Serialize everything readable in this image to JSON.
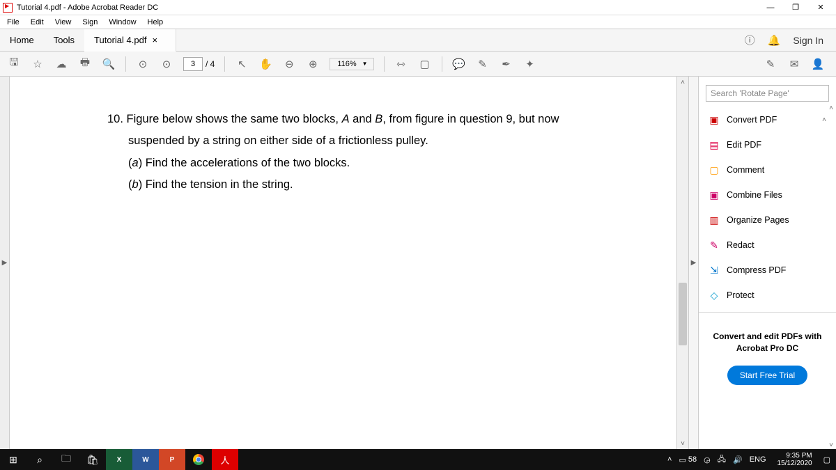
{
  "title": "Tutorial 4.pdf - Adobe Acrobat Reader DC",
  "menu": {
    "file": "File",
    "edit": "Edit",
    "view": "View",
    "sign": "Sign",
    "window": "Window",
    "help": "Help"
  },
  "tabs": {
    "home": "Home",
    "tools": "Tools",
    "file": "Tutorial 4.pdf"
  },
  "signin": "Sign In",
  "page": {
    "current": "3",
    "total": "/ 4"
  },
  "zoom": "116%",
  "doc": {
    "line1": "10. Figure below shows the same two blocks, ",
    "a": "A",
    "and": " and ",
    "b": "B",
    "line1b": ", from figure in question 9, but now",
    "line2": "suspended by a string on either side of a frictionless pulley.",
    "pa": "(",
    "paL": "a",
    "pa2": ") Find the accelerations of the two blocks.",
    "pb": "(",
    "pbL": "b",
    "pb2": ") Find the tension in the string."
  },
  "search_placeholder": "Search 'Rotate Page'",
  "tools_list": {
    "convert": "Convert PDF",
    "edit": "Edit PDF",
    "comment": "Comment",
    "combine": "Combine Files",
    "organize": "Organize Pages",
    "redact": "Redact",
    "compress": "Compress PDF",
    "protect": "Protect"
  },
  "promo": {
    "text": "Convert and edit PDFs with Acrobat Pro DC",
    "btn": "Start Free Trial"
  },
  "tray": {
    "batt": "58",
    "lang": "ENG",
    "time": "9:35 PM",
    "date": "15/12/2020"
  }
}
